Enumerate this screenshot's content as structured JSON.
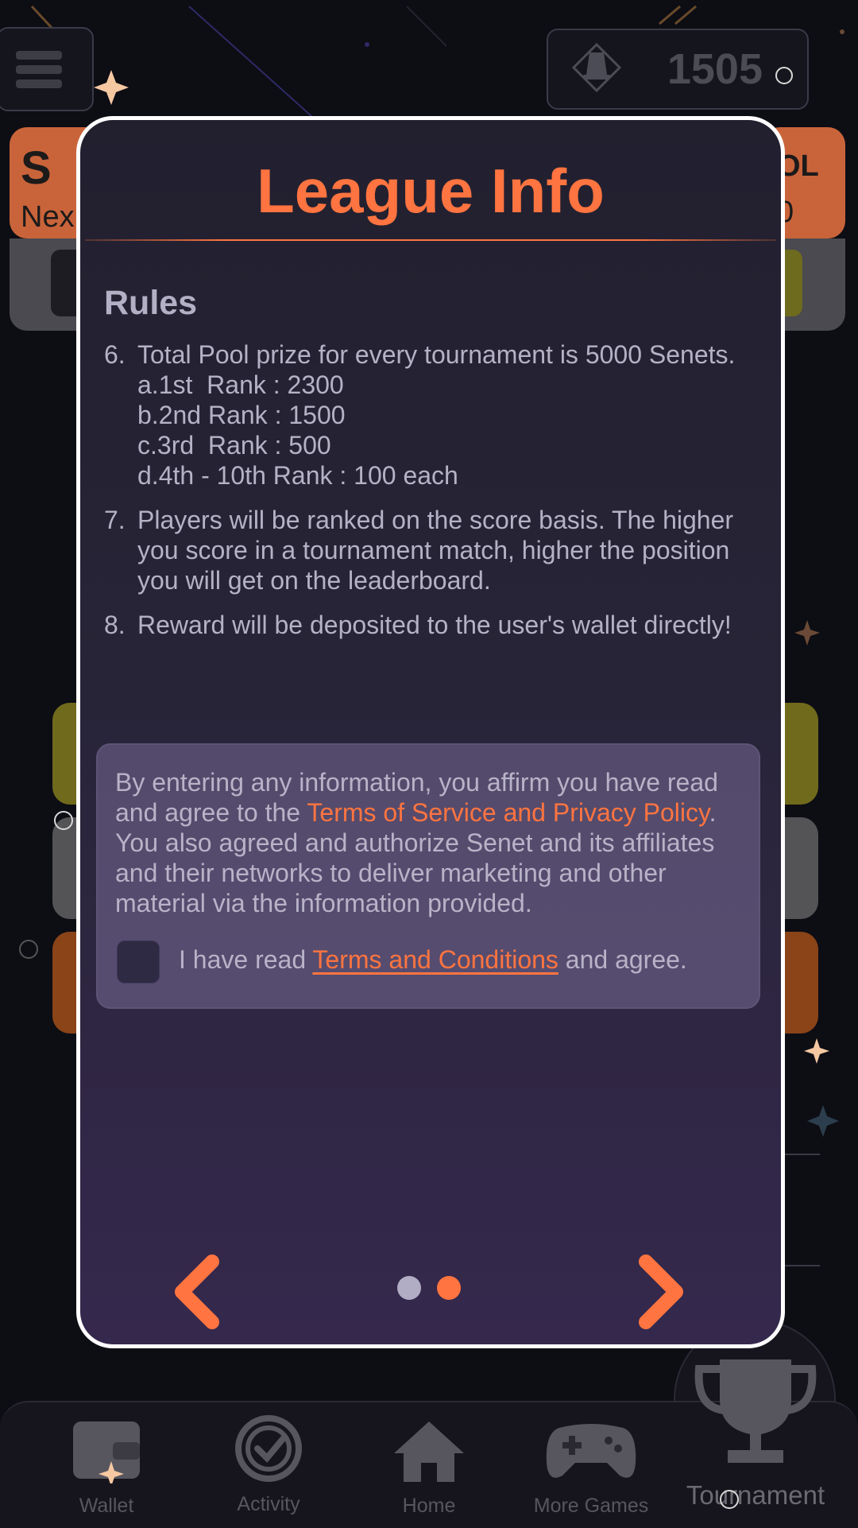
{
  "header": {
    "coin_balance": "1505"
  },
  "background_card": {
    "letter_left": "S",
    "letter_right": "OL",
    "next_prefix": "Nex",
    "digit_right": "0"
  },
  "modal": {
    "title": "League Info",
    "rules_heading": "Rules",
    "rules": [
      {
        "number": "6.",
        "text": "Total Pool prize for every tournament is 5000 Senets.",
        "sub_items": [
          "a.1st  Rank : 2300",
          "b.2nd Rank : 1500",
          "c.3rd  Rank : 500",
          "d.4th - 10th Rank : 100 each"
        ]
      },
      {
        "number": "7.",
        "text": "Players will be ranked on the score basis. The higher you score in a tournament match, higher the position you will get on the leaderboard."
      },
      {
        "number": "8.",
        "text": "Reward will be deposited to the user's wallet directly!"
      }
    ],
    "consent": {
      "text_before": "By entering any information, you affirm you have read and agree to the ",
      "link": "Terms of Service and Privacy Policy",
      "text_after": ". You also agreed and authorize Senet and its affiliates and their networks to deliver marketing and other material via the information provided.",
      "checkbox_prefix": "I have read ",
      "checkbox_link": "Terms and Conditions",
      "checkbox_suffix": " and agree."
    },
    "pagination": {
      "current_page": 2,
      "total_pages": 2
    }
  },
  "bottom_nav": {
    "items": [
      {
        "label": "Wallet",
        "icon": "wallet-icon"
      },
      {
        "label": "Activity",
        "icon": "activity-check-icon"
      },
      {
        "label": "Home",
        "icon": "home-icon"
      },
      {
        "label": "More Games",
        "icon": "gamepad-icon"
      },
      {
        "label": "Tournament",
        "icon": "trophy-icon"
      }
    ]
  },
  "colors": {
    "accent": "#ff7440",
    "modal_border": "#ffffff",
    "text": "#b5b2c6",
    "dot_inactive": "#b0adc4"
  }
}
